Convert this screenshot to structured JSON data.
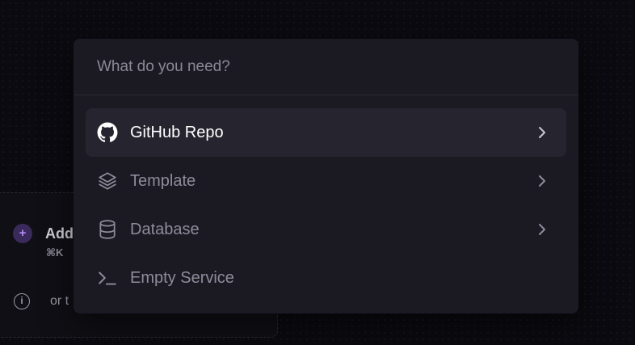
{
  "background": {
    "add_label": "Add",
    "shortcut": "⌘K",
    "info_text": "or t"
  },
  "palette": {
    "search": {
      "placeholder": "What do you need?",
      "value": ""
    },
    "options": [
      {
        "label": "GitHub Repo",
        "icon": "github-icon",
        "has_chevron": true,
        "active": true
      },
      {
        "label": "Template",
        "icon": "layers-icon",
        "has_chevron": true,
        "active": false
      },
      {
        "label": "Database",
        "icon": "database-icon",
        "has_chevron": true,
        "active": false
      },
      {
        "label": "Empty Service",
        "icon": "terminal-icon",
        "has_chevron": false,
        "active": false
      }
    ]
  },
  "colors": {
    "page_bg": "#0b0a10",
    "palette_bg": "#1b1a23",
    "active_row_bg": "#26252f",
    "muted_text": "#8f8c9a",
    "active_text": "#ffffff",
    "accent_purple": "#b48cf2"
  }
}
